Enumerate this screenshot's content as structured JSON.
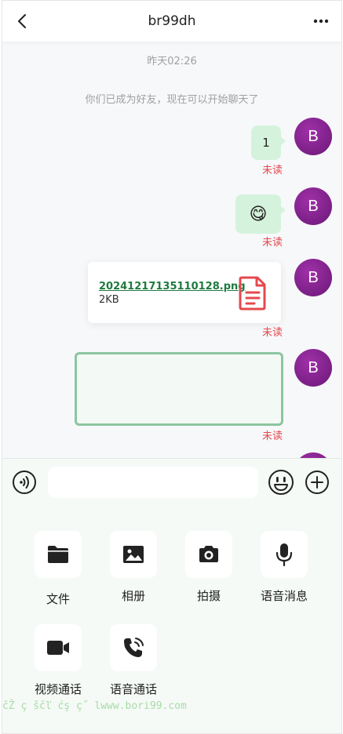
{
  "header": {
    "title": "br99dh"
  },
  "chat": {
    "timestamp": "昨天02:26",
    "system_message": "你们已成为好友，现在可以开始聊天了",
    "avatar_letter": "B",
    "messages": [
      {
        "type": "text",
        "text": "1",
        "status": "未读"
      },
      {
        "type": "emoji",
        "text": "😋",
        "status": "未读"
      },
      {
        "type": "file",
        "file_name": "20241217135110128.png",
        "file_size": "2KB",
        "status": "未读"
      },
      {
        "type": "empty",
        "status": "未读"
      }
    ]
  },
  "input": {
    "placeholder": ""
  },
  "tools": [
    {
      "label": "文件",
      "icon": "folder-icon"
    },
    {
      "label": "相册",
      "icon": "image-icon"
    },
    {
      "label": "拍摄",
      "icon": "camera-icon"
    },
    {
      "label": "语音消息",
      "icon": "microphone-icon"
    },
    {
      "label": "视频通话",
      "icon": "video-camera-icon"
    },
    {
      "label": "语音通话",
      "icon": "phone-icon"
    }
  ],
  "watermark": "čŽ ç ščľ ćş ç˝ lwww.bori99.com",
  "colors": {
    "accent": "#1d7a3f",
    "bubble": "#d5f3dc",
    "unread": "#e5484d",
    "avatar": "#7d1e8a"
  }
}
